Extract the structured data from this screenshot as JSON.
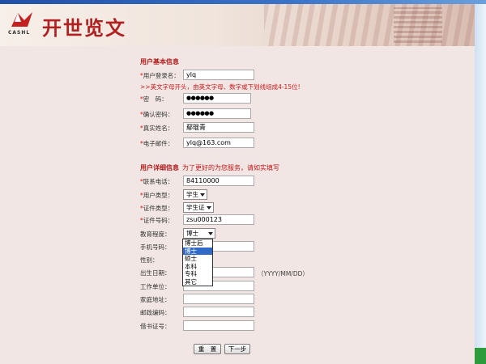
{
  "header": {
    "brand": "开世览文",
    "logo_text": "CASHL"
  },
  "basic": {
    "title": "用户基本信息",
    "hint": ">>英文字母开头，由英文字母、数字或下划线组成4-15位!",
    "fields": [
      {
        "label": "用户登录名：",
        "required": "*",
        "value": "ylq"
      },
      {
        "label": "密　码：",
        "required": "*",
        "value": "●●●●●●"
      },
      {
        "label": "确认密码：",
        "required": "*",
        "value": "●●●●●●"
      },
      {
        "label": "真实姓名：",
        "required": "*",
        "value": "鄢琨青"
      },
      {
        "label": "电子邮件：",
        "required": "*",
        "value": "ylq@163.com"
      }
    ]
  },
  "detail": {
    "title": "用户详细信息",
    "note": "为了更好的为您服务，请如实填写",
    "phone": {
      "label": "联系电话：",
      "required": "*",
      "value": "84110000"
    },
    "user_type": {
      "label": "用户类型：",
      "required": "*",
      "value": "学生"
    },
    "id_type": {
      "label": "证件类型：",
      "required": "*",
      "value": "学生证"
    },
    "id_number": {
      "label": "证件号码：",
      "required": "*",
      "value": "zsu000123"
    },
    "education": {
      "label": "教育程度：",
      "value": "博士",
      "options": [
        "博士后",
        "博士",
        "硕士",
        "本科",
        "专科",
        "其它"
      ],
      "highlighted": "博士"
    },
    "mobile": {
      "label": "手机号码："
    },
    "gender": {
      "label": "性别："
    },
    "birth": {
      "label": "出生日期：",
      "format_hint": "（YYYY/MM/DD）"
    },
    "work": {
      "label": "工作单位："
    },
    "address": {
      "label": "家庭地址："
    },
    "zip": {
      "label": "邮政编码："
    },
    "library_card": {
      "label": "借书证号："
    }
  },
  "actions": {
    "reset": "重　置",
    "next": "下一步"
  },
  "colors": {
    "accent_red": "#b01818",
    "content_bg": "#f1e6e3",
    "selected_blue": "#3169c6"
  }
}
